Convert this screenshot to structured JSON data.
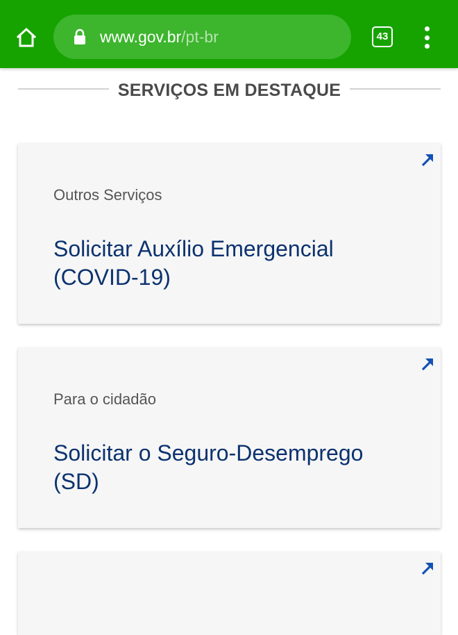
{
  "browser": {
    "url_host": "www.gov.br",
    "url_path": "/pt-br",
    "tab_count": "43",
    "theme_color": "#16a300",
    "icons": [
      "home-icon",
      "lock-icon",
      "tab-switcher-icon",
      "more-vert-icon"
    ]
  },
  "section": {
    "title": "SERVIÇOS EM DESTAQUE"
  },
  "cards": [
    {
      "category": "Outros Serviços",
      "title": "Solicitar Auxílio Emergencial (COVID-19)",
      "icon": "external-arrow-icon"
    },
    {
      "category": "Para o cidadão",
      "title": "Solicitar o Seguro-Desemprego (SD)",
      "icon": "external-arrow-icon"
    },
    {
      "category": "",
      "title": "",
      "icon": "external-arrow-icon"
    }
  ],
  "colors": {
    "title_blue": "#0c326f",
    "arrow_blue": "#1351b4",
    "card_bg": "#f6f6f6",
    "heading_gray": "#4a4a4a"
  }
}
